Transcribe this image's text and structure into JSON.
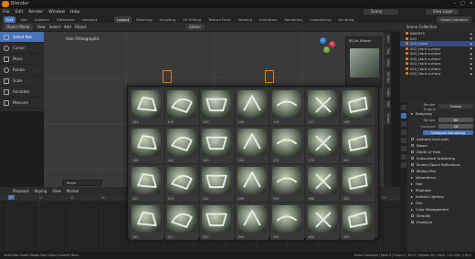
{
  "titlebar": {
    "title": "Blender",
    "controls": [
      "–",
      "□",
      "✕"
    ]
  },
  "menu": {
    "items": [
      "File",
      "Edit",
      "Render",
      "Window",
      "Help"
    ],
    "scene": "Scene",
    "view_layer": "View Layer"
  },
  "workspaces": {
    "mode": "Edit",
    "tabs": [
      "Layout",
      "Modeling",
      "Sculpting",
      "UV Editing",
      "Texture Paint",
      "Shading",
      "Animation",
      "Rendering",
      "Compositing",
      "Scripting"
    ],
    "active": "Layout",
    "mode_tabs": [
      "Add",
      "Subtract",
      "Difference",
      "Intersect"
    ],
    "options": "Object Location"
  },
  "toolbar": {
    "mode_select": "Object Mode",
    "items": [
      "View",
      "Select",
      "Add",
      "Object"
    ],
    "transform": "Global"
  },
  "tools": [
    {
      "label": "Select Box",
      "icon": "select-box-icon",
      "active": true
    },
    {
      "label": "Cursor",
      "icon": "cursor-icon",
      "active": false
    },
    {
      "label": "Move",
      "icon": "move-icon",
      "active": false
    },
    {
      "label": "Rotate",
      "icon": "rotate-icon",
      "active": false
    },
    {
      "label": "Scale",
      "icon": "scale-icon",
      "active": false
    },
    {
      "label": "Annotate",
      "icon": "annotate-icon",
      "active": false
    },
    {
      "label": "Measure",
      "icon": "measure-icon",
      "active": false
    }
  ],
  "viewport": {
    "label": "User Orthographic",
    "operator": "Place",
    "gizmo": {
      "x": "X",
      "y": "Y",
      "z": "Z"
    }
  },
  "side_tabs": [
    "Item",
    "Tool",
    "View",
    "Kit Ops",
    "HOps",
    "Edit",
    "Create",
    "Cycles",
    "Display",
    "BC",
    "Asset"
  ],
  "asset_panel": {
    "title": "KB Art Kitbash"
  },
  "popup": {
    "items": [
      {
        "id": "101"
      },
      {
        "id": "102"
      },
      {
        "id": "103"
      },
      {
        "id": "104"
      },
      {
        "id": "114"
      },
      {
        "id": "117"
      },
      {
        "id": "128"
      },
      {
        "id": "136"
      },
      {
        "id": "141"
      },
      {
        "id": "150"
      },
      {
        "id": "153"
      },
      {
        "id": "172"
      },
      {
        "id": "175"
      },
      {
        "id": "201"
      },
      {
        "id": "205"
      },
      {
        "id": "210"
      },
      {
        "id": "232"
      },
      {
        "id": "245"
      },
      {
        "id": "252"
      },
      {
        "id": "260"
      },
      {
        "id": "282"
      },
      {
        "id": "302"
      },
      {
        "id": "311"
      },
      {
        "id": "352"
      },
      {
        "id": "390"
      },
      {
        "id": "410"
      },
      {
        "id": "445"
      },
      {
        "id": "455"
      }
    ]
  },
  "timeline": {
    "header": [
      "Playback",
      "Keying",
      "View",
      "Marker"
    ],
    "ruler": [
      "0",
      "20",
      "40",
      "60",
      "80",
      "100",
      "120",
      "140",
      "160",
      "180",
      "200",
      "220",
      "240"
    ],
    "current_frame": "1"
  },
  "outliner": {
    "title": "Scene Collection",
    "rows": [
      {
        "label": "INSERTS",
        "selected": false
      },
      {
        "label": "002",
        "selected": false
      },
      {
        "label": "002_Kasel",
        "selected": true
      },
      {
        "label": "002_Hard surface",
        "selected": false
      },
      {
        "label": "002_Hard surface",
        "selected": false
      },
      {
        "label": "002_Hard surface",
        "selected": false
      },
      {
        "label": "002_Hard surface",
        "selected": false
      },
      {
        "label": "002_Hard surface",
        "selected": false
      },
      {
        "label": "002_Hard surface",
        "selected": false
      }
    ]
  },
  "properties": {
    "engine_label": "Render Engine",
    "engine": "Eevee",
    "sampling": "Sampling",
    "render_label": "Render",
    "render_val": "64",
    "viewport_label": "Viewport",
    "viewport_val": "16",
    "denoise": "Viewport Denoising",
    "sections": [
      "Ambient Occlusion",
      "Bloom",
      "Depth of Field",
      "Subsurface Scattering",
      "Screen Space Reflections",
      "Motion Blur",
      "Volumetrics",
      "Hair",
      "Shadows",
      "Indirect Lighting",
      "Film",
      "Color Management",
      "Simplify",
      "Freestyle"
    ]
  },
  "statusbar": {
    "left": "Select   Box Select   Rotate View   Object Context Menu",
    "right": "Scene Collection | Verts 0 | Faces 0 | Tris 0 | Objects 0/0 | Mem: 1.01 GiB | 2.90.0"
  }
}
